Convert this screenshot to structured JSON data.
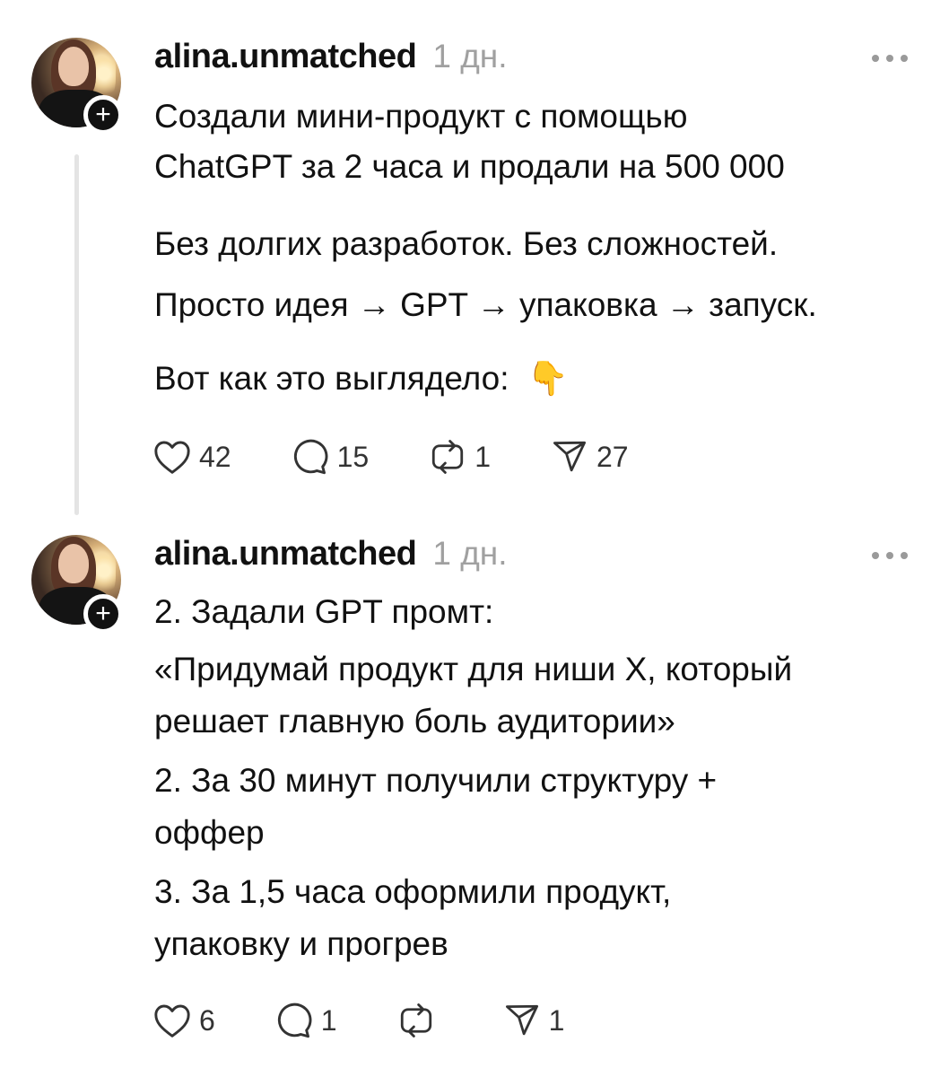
{
  "posts": [
    {
      "username": "alina.unmatched",
      "time": "1 дн.",
      "lines": [
        "Создали мини-продукт с помощью",
        "ChatGPT за 2 часа и продали на 500 000",
        "Без долгих разработок. Без сложностей.",
        "Просто идея → GPT → упаковка → запуск.",
        "Вот как это выглядело:"
      ],
      "emoji": "👇",
      "likes": "42",
      "comments": "15",
      "reposts": "1",
      "shares": "27"
    },
    {
      "username": "alina.unmatched",
      "time": "1 дн.",
      "lines": [
        "2. Задали GPT промт:",
        "«Придумай продукт для ниши Х, который",
        "решает главную боль аудитории»",
        "2. За 30 минут получили структуру +",
        "оффер",
        "3. За 1,5 часа оформили продукт,",
        "упаковку и прогрев"
      ],
      "likes": "6",
      "comments": "1",
      "reposts": "",
      "shares": "1"
    }
  ],
  "badge_symbol": "+",
  "icons": {
    "like": "heart-icon",
    "comment": "comment-bubble-icon",
    "repost": "repost-icon",
    "share": "send-icon",
    "more": "more-dots-icon"
  }
}
